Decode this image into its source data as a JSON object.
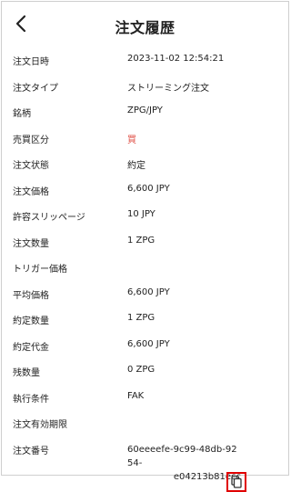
{
  "header": {
    "title": "注文履歴"
  },
  "rows": [
    {
      "label": "注文日時",
      "value": "2023-11-02 12:54:21"
    },
    {
      "label": "注文タイプ",
      "value": "ストリーミング注文"
    },
    {
      "label": "銘柄",
      "value": "ZPG/JPY"
    },
    {
      "label": "売買区分",
      "value": "買"
    },
    {
      "label": "注文状態",
      "value": "約定"
    },
    {
      "label": "注文価格",
      "value": "6,600 JPY"
    },
    {
      "label": "許容スリッページ",
      "value": "10 JPY"
    },
    {
      "label": "注文数量",
      "value": "1 ZPG"
    },
    {
      "label": "トリガー価格",
      "value": ""
    },
    {
      "label": "平均価格",
      "value": "6,600 JPY"
    },
    {
      "label": "約定数量",
      "value": "1 ZPG"
    },
    {
      "label": "約定代金",
      "value": "6,600 JPY"
    },
    {
      "label": "残数量",
      "value": "0 ZPG"
    },
    {
      "label": "執行条件",
      "value": "FAK"
    },
    {
      "label": "注文有効期限",
      "value": ""
    }
  ],
  "order_number": {
    "label": "注文番号",
    "value_line1": "60eeeefe-9c99-48db-9254-",
    "value_line2": "e04213b81ecc"
  },
  "colors": {
    "buy": "#e0534a",
    "highlight": "#e00000"
  },
  "icons": {
    "back": "chevron-left-icon",
    "copy": "copy-icon"
  }
}
